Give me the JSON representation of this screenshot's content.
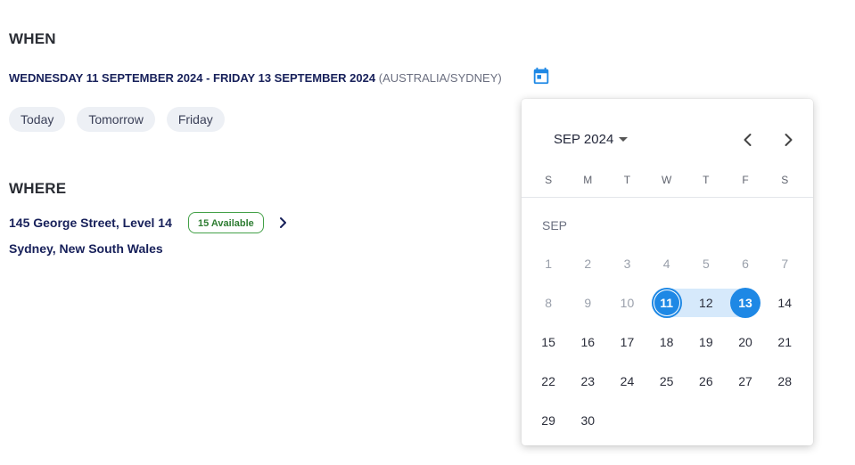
{
  "when": {
    "title": "WHEN",
    "date_range": "WEDNESDAY 11 SEPTEMBER 2024 - FRIDAY 13 SEPTEMBER 2024",
    "timezone": "(AUSTRALIA/SYDNEY)",
    "quick_picks": [
      "Today",
      "Tomorrow",
      "Friday"
    ]
  },
  "where": {
    "title": "WHERE",
    "address_line1": "145 George Street, Level 14",
    "address_line2": "Sydney, New South Wales",
    "availability": "15 Available"
  },
  "calendar": {
    "month_year": "SEP 2024",
    "month_label": "SEP",
    "weekdays": [
      "S",
      "M",
      "T",
      "W",
      "T",
      "F",
      "S"
    ],
    "weeks": [
      [
        "1",
        "2",
        "3",
        "4",
        "5",
        "6",
        "7"
      ],
      [
        "8",
        "9",
        "10",
        "11",
        "12",
        "13",
        "14"
      ],
      [
        "15",
        "16",
        "17",
        "18",
        "19",
        "20",
        "21"
      ],
      [
        "22",
        "23",
        "24",
        "25",
        "26",
        "27",
        "28"
      ],
      [
        "29",
        "30",
        "",
        "",
        "",
        "",
        ""
      ]
    ],
    "range_start": 11,
    "range_end": 13,
    "first_enabled_day": 11
  },
  "colors": {
    "accent": "#1e88e5",
    "range_fill": "#d6e9fb",
    "badge_green": "#43a047",
    "text_navy": "#17205a"
  },
  "icons": {
    "calendar_trigger": "calendar-icon",
    "prev": "chevron-left-icon",
    "next": "chevron-right-icon",
    "address_more": "chevron-right-icon"
  }
}
